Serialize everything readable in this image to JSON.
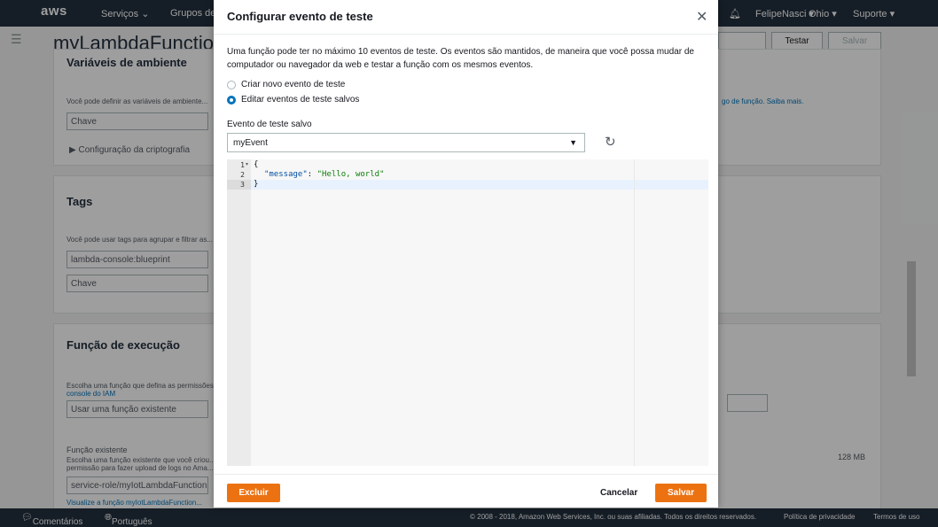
{
  "topnav": {
    "logo": "aws",
    "services": "Serviços",
    "groups": "Grupos de",
    "user": "FelipeNasci",
    "region": "Ohio",
    "support": "Suporte"
  },
  "background": {
    "function_name": "myLambdaFunction",
    "test_button": "Testar",
    "save_button": "Salvar",
    "env_vars_title": "Variáveis de ambiente",
    "env_vars_text": "Você pode definir as variáveis de ambiente...",
    "key_placeholder": "Chave",
    "encryption_config": "▶ Configuração da criptografia",
    "side_link": "go de função. Saiba mais.",
    "tags_title": "Tags",
    "tags_text": "Você pode usar tags para agrupar e filtrar as...",
    "tag_value": "lambda-console:blueprint",
    "tag_key_placeholder": "Chave",
    "exec_role_title": "Função de execução",
    "exec_role_text": "Escolha uma função que defina as permissões",
    "iam_link": "console do IAM",
    "role_select": "Usar uma função existente",
    "existing_role_label": "Função existente",
    "existing_role_text": "Escolha uma função existente que você criou...",
    "existing_role_text2": "permissão para fazer upload de logs no Ama...",
    "role_value": "service-role/myIotLambdaFunction",
    "role_view_link": "Visualize a função myIotLambdaFunction...",
    "memory_value": "128 MB"
  },
  "footer": {
    "comments": "Comentários",
    "language": "Português",
    "copyright": "© 2008 - 2018, Amazon Web Services, Inc. ou suas afiliadas. Todos os direitos reservados.",
    "privacy": "Política de privacidade",
    "terms": "Termos de uso"
  },
  "modal": {
    "title": "Configurar evento de teste",
    "description": "Uma função pode ter no máximo 10 eventos de teste. Os eventos são mantidos, de maneira que você possa mudar de computador ou navegador da web e testar a função com os mesmos eventos.",
    "radio_options": [
      {
        "label": "Criar novo evento de teste",
        "selected": false
      },
      {
        "label": "Editar eventos de teste salvos",
        "selected": true
      }
    ],
    "saved_event_label": "Evento de teste salvo",
    "saved_event_value": "myEvent",
    "editor": {
      "line_numbers": [
        "1",
        "2",
        "3"
      ],
      "line1": "{",
      "key": "\"message\"",
      "colon": ": ",
      "value": "\"Hello, world\"",
      "line3": "}"
    },
    "delete_button": "Excluir",
    "cancel_button": "Cancelar",
    "save_button": "Salvar"
  },
  "colors": {
    "accent_orange": "#ec7211",
    "radio_blue": "#0073bb",
    "nav_dark": "#232f3e"
  }
}
